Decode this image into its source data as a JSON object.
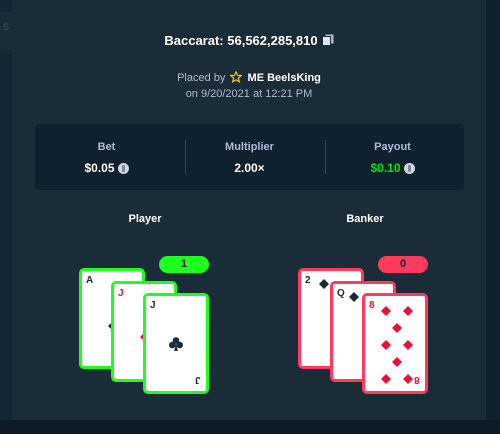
{
  "background": {
    "sidebar_fragment": "S"
  },
  "bet": {
    "game": "Baccarat",
    "id": "56,562,285,810",
    "title": "Baccarat: 56,562,285,810",
    "placed_by_prefix": "Placed by",
    "username": "ME BeelsKing",
    "date": "on 9/20/2021 at 12:21 PM"
  },
  "stats": {
    "bet_label": "Bet",
    "bet_value": "$0.05",
    "multiplier_label": "Multiplier",
    "multiplier_value": "2.00×",
    "payout_label": "Payout",
    "payout_value": "$0.10"
  },
  "hands": {
    "player": {
      "label": "Player",
      "score": "1",
      "result_color": "#1fff20",
      "cards": [
        {
          "rank": "A",
          "suit": "diamond",
          "suit_color": "black"
        },
        {
          "rank": "J",
          "suit": "diamond",
          "suit_color": "red"
        },
        {
          "rank": "J",
          "suit": "club",
          "suit_color": "black"
        }
      ]
    },
    "banker": {
      "label": "Banker",
      "score": "0",
      "result_color": "#ff3a5c",
      "cards": [
        {
          "rank": "2",
          "suit": "diamond",
          "suit_color": "black"
        },
        {
          "rank": "Q",
          "suit": "diamond",
          "suit_color": "black"
        },
        {
          "rank": "8",
          "suit": "diamond",
          "suit_color": "red"
        }
      ]
    }
  },
  "colors": {
    "background": "#0f212e",
    "modal": "#1a2c38",
    "win_green": "#1fff20",
    "payout_green": "#00e701",
    "lose_red": "#ff3a5c"
  },
  "icons": [
    "copy-icon",
    "star-icon",
    "coin-icon",
    "diamond-suit",
    "club-suit"
  ]
}
